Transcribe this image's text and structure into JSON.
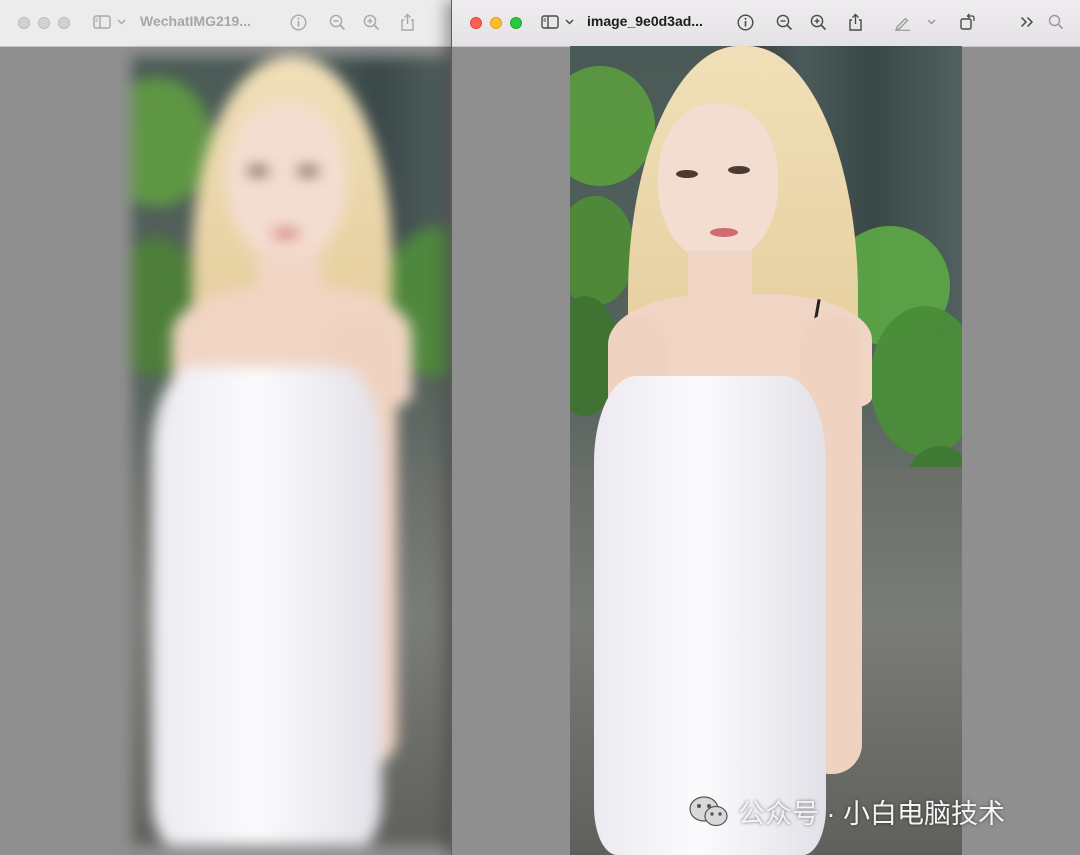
{
  "windows": {
    "back": {
      "title": "WechatIMG219...",
      "state": "inactive",
      "image": "blurred portrait photo"
    },
    "front": {
      "title": "image_9e0d3ad...",
      "state": "active",
      "image": "sharp portrait photo"
    }
  },
  "toolbar_icons": [
    "sidebar-icon",
    "chevron-down-icon",
    "info-icon",
    "zoom-out-icon",
    "zoom-in-icon",
    "share-icon",
    "markup-pen-icon",
    "rotate-icon",
    "more-chevrons-icon",
    "search-icon"
  ],
  "colors": {
    "desktop": "#8f8f8f",
    "titlebar": "#e9e7e9",
    "close": "#fe5f57",
    "minimize": "#febc2e",
    "zoom": "#28c840"
  },
  "watermark": {
    "text": "公众号 · 小白电脑技术",
    "icon": "wechat-icon"
  }
}
